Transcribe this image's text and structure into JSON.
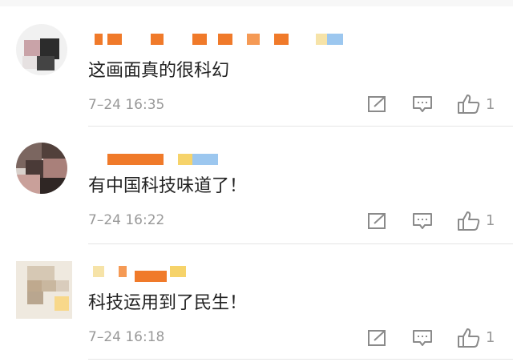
{
  "comments": [
    {
      "text": "这画面真的很科幻",
      "time": "7–24 16:35",
      "like_count": "1",
      "icons": [
        "share-icon",
        "comment-icon",
        "like-icon"
      ]
    },
    {
      "text": "有中国科技味道了！",
      "time": "7–24 16:22",
      "like_count": "1",
      "icons": [
        "share-icon",
        "comment-icon",
        "like-icon"
      ]
    },
    {
      "text": "科技运用到了民生！",
      "time": "7–24 16:18",
      "like_count": "1",
      "icons": [
        "share-icon",
        "comment-icon",
        "like-icon"
      ]
    }
  ],
  "colors": {
    "text": "#222222",
    "meta": "#999999",
    "icon": "#8a8a8a",
    "divider": "#e5e5e5",
    "redact_orange": "#f07a2a",
    "redact_light": "#f6b98a",
    "redact_blue": "#9cc7ef",
    "redact_yellow": "#f6e3a8"
  }
}
